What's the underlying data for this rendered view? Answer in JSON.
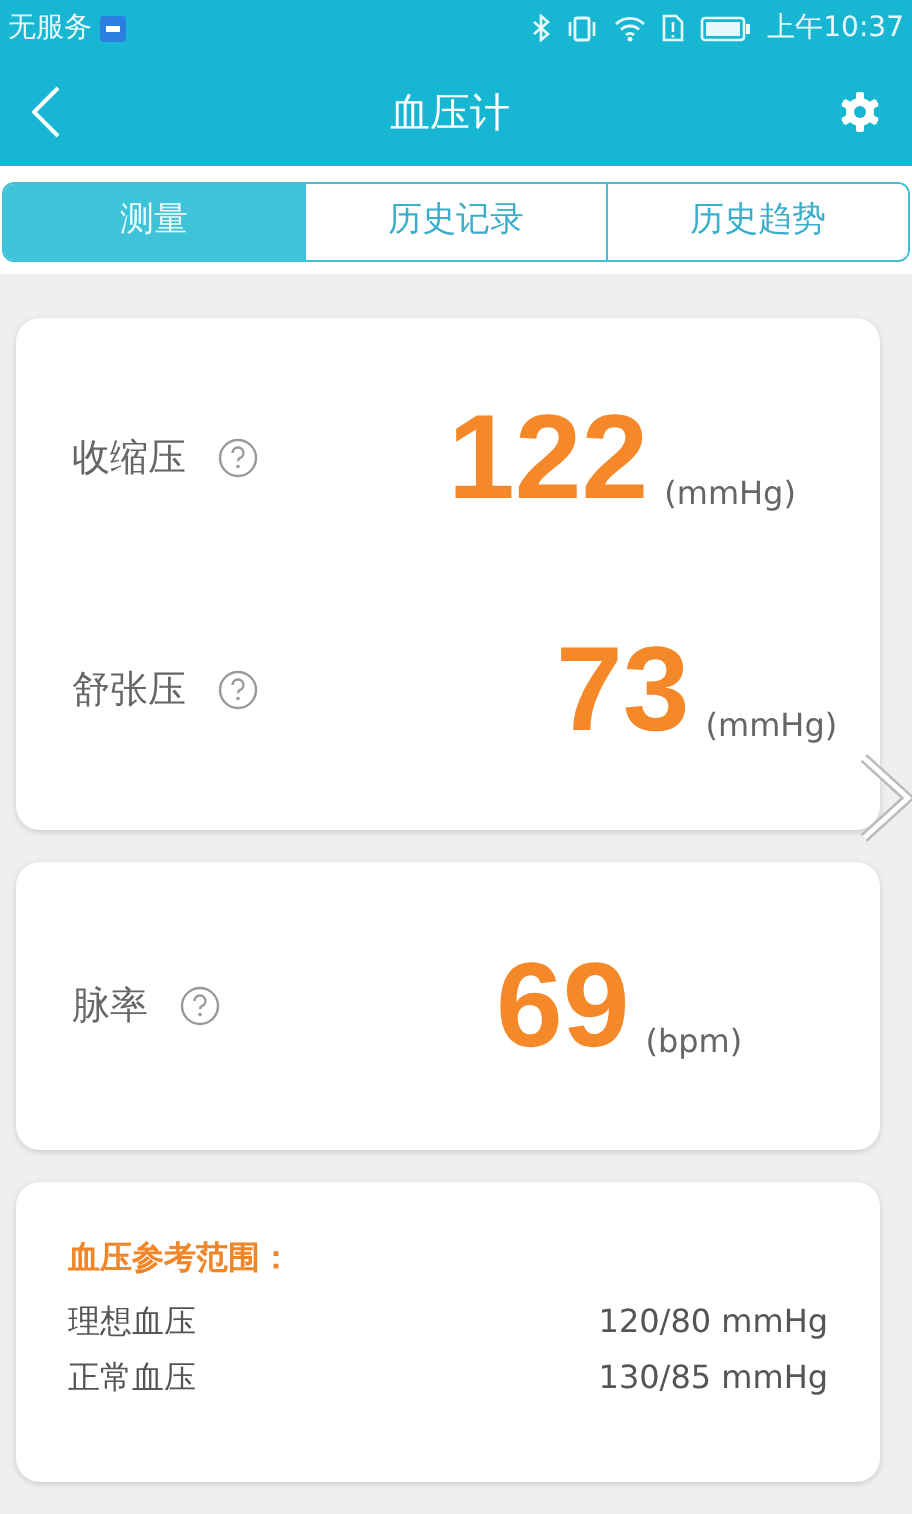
{
  "status_bar": {
    "carrier": "无服务",
    "time": "上午10:37"
  },
  "header": {
    "title": "血压计"
  },
  "tabs": [
    {
      "label": "测量",
      "selected": true
    },
    {
      "label": "历史记录",
      "selected": false
    },
    {
      "label": "历史趋势",
      "selected": false
    }
  ],
  "pressure_card": {
    "readings": [
      {
        "label": "收缩压",
        "value": "122",
        "unit": "(mmHg)"
      },
      {
        "label": "舒张压",
        "value": "73",
        "unit": "(mmHg)"
      }
    ]
  },
  "pulse_card": {
    "readings": [
      {
        "label": "脉率",
        "value": "69",
        "unit": "(bpm)"
      }
    ]
  },
  "reference": {
    "title": "血压参考范围：",
    "rows": [
      {
        "label": "理想血压",
        "value": "120/80 mmHg"
      },
      {
        "label": "正常血压",
        "value": "130/85 mmHg"
      }
    ]
  }
}
